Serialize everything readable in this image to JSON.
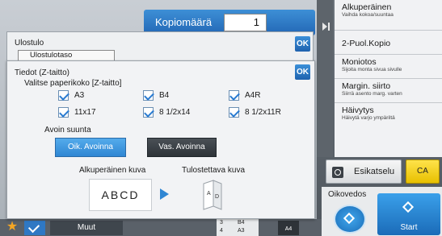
{
  "top": {
    "copies_label": "Kopiomäärä",
    "copies_value": "1"
  },
  "side_menu": [
    {
      "title": "Alkuperäinen",
      "subtitle": "Vaihda kokoa/suuntaa"
    },
    {
      "title": "2-Puol.Kopio",
      "subtitle": ""
    },
    {
      "title": "Moniotos",
      "subtitle": "Sijoita monta sivua sivulle"
    },
    {
      "title": "Margin. siirto",
      "subtitle": "Siirrä asento marg. varten"
    },
    {
      "title": "Häivytys",
      "subtitle": "Häivytä varjo ympäriltä"
    }
  ],
  "right_bottom": {
    "preview_label": "Esikatselu",
    "ca_label": "CA",
    "proof_label": "Oikovedos",
    "start_label": "Start"
  },
  "bottom_bar": {
    "other_label": "Muut",
    "tray_rows": [
      {
        "num": "3",
        "size": "B4"
      },
      {
        "num": "4",
        "size": "A3"
      }
    ],
    "paper_badge": "A4"
  },
  "output_dialog": {
    "title": "Ulostulo",
    "tab_label": "Ulostulotaso",
    "ok_label": "OK"
  },
  "fold_dialog": {
    "title": "Tiedot (Z-taitto)",
    "subtitle": "Valitse paperikoko [Z-taitto]",
    "ok_label": "OK",
    "paper_sizes": [
      "A3",
      "B4",
      "A4R",
      "11x17",
      "8 1/2x14",
      "8 1/2x11R"
    ],
    "direction_label": "Avoin suunta",
    "direction_right": "Oik. Avoinna",
    "direction_left": "Vas. Avoinna",
    "original_label": "Alkuperäinen kuva",
    "printed_label": "Tulostettava kuva",
    "sample_text": "ABCD"
  }
}
